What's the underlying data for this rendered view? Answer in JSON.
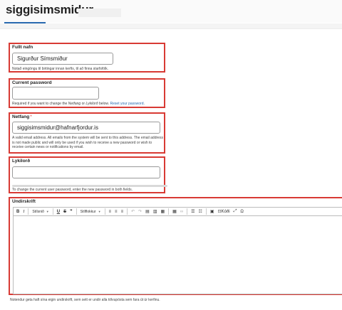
{
  "page": {
    "title": "siggisimsmidur"
  },
  "full_name": {
    "label": "Fullt nafn",
    "value": "Sigurður Símsmiður",
    "help": "Notað eingöngu til birtingar innan kerfis, til að finna starfsfólk."
  },
  "current_password": {
    "label": "Current password",
    "value": "",
    "help_prefix": "Required if you want to change the ",
    "help_email_term": "Netfang",
    "help_or": " or ",
    "help_password_term": "Lykilorð",
    "help_below": " below. ",
    "help_link": "Reset your password",
    "help_end": "."
  },
  "email": {
    "label": "Netfang",
    "required_mark": "*",
    "value": "siggisimsmidur@hafnarfjordur.is",
    "help": "A valid email address. All emails from the system will be sent to this address. The email address is not made public and will only be used if you wish to receive a new password or wish to receive certain news or notifications by email."
  },
  "password": {
    "label": "Lykilorð",
    "value": "",
    "help": "To change the current user password, enter the new password in both fields."
  },
  "signature": {
    "label": "Undirskrift",
    "toolbar": {
      "bold": "B",
      "italic": "I",
      "style_select": "Stílsnið",
      "underline": "U",
      "strike": "S",
      "quote": "❞",
      "paragraph_select": "Stílflokkur",
      "code": "Kóði"
    },
    "help": "Notendur geta haft sína eigin undirskrift, sem sett er undir alla tölvupósta sem fara út úr kerfinu."
  }
}
